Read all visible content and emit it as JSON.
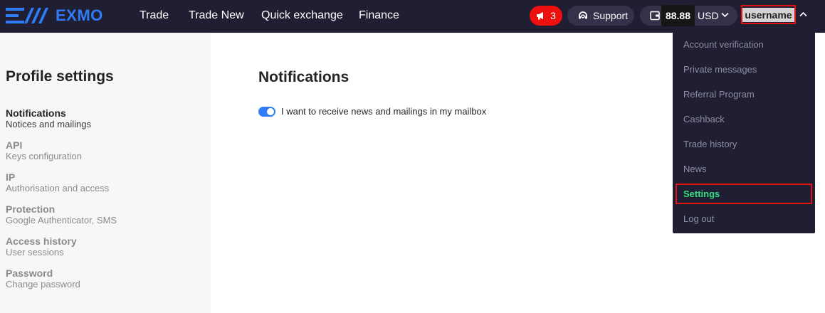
{
  "app": {
    "logo_text": "EXMO",
    "nav": [
      "Trade",
      "Trade New",
      "Quick exchange",
      "Finance"
    ],
    "notifications_count": "3",
    "support_label": "Support",
    "balance": {
      "value": "88.88",
      "currency": "USD"
    },
    "username": "username"
  },
  "sidebar": {
    "title": "Profile settings",
    "items": [
      {
        "title": "Notifications",
        "subtitle": "Notices and mailings",
        "active": true
      },
      {
        "title": "API",
        "subtitle": "Keys configuration",
        "active": false
      },
      {
        "title": "IP",
        "subtitle": "Authorisation and access",
        "active": false
      },
      {
        "title": "Protection",
        "subtitle": "Google Authenticator, SMS",
        "active": false
      },
      {
        "title": "Access history",
        "subtitle": "User sessions",
        "active": false
      },
      {
        "title": "Password",
        "subtitle": "Change password",
        "active": false
      }
    ]
  },
  "main": {
    "title": "Notifications",
    "toggle_label": "I want to receive news and mailings in my mailbox",
    "toggle_on": true
  },
  "user_menu": {
    "items": [
      "Account verification",
      "Private messages",
      "Referral Program",
      "Cashback",
      "Trade history",
      "News",
      "Settings",
      "Log out"
    ],
    "active_item": "Settings"
  },
  "colors": {
    "topbar_bg": "#201e33",
    "brand_blue": "#2f7df6",
    "badge_red": "#ee0f0f",
    "menu_active_green": "#2fe07f",
    "sidebar_bg": "#f7f7f7"
  }
}
